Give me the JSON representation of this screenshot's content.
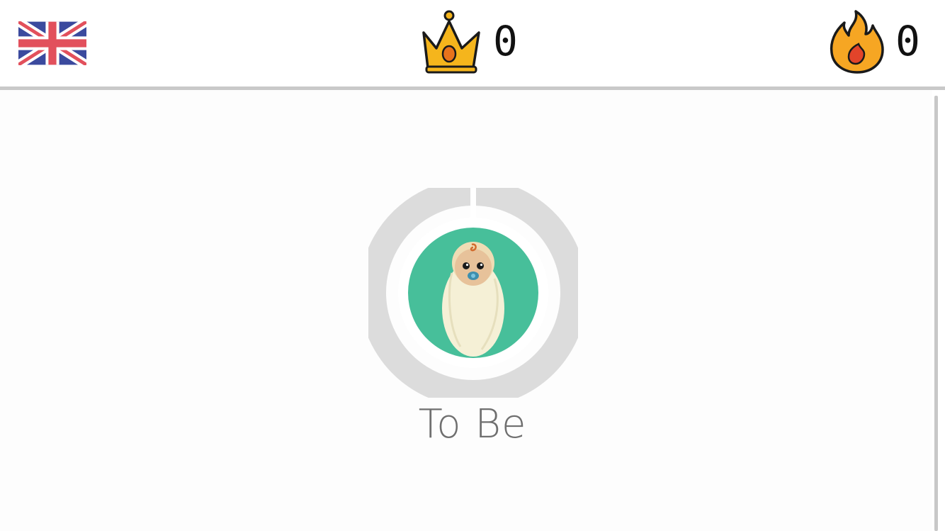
{
  "header": {
    "language_flag_icon": "uk-flag-icon",
    "crown": {
      "icon": "crown-icon",
      "count": "0"
    },
    "streak": {
      "icon": "fire-icon",
      "count": "0"
    }
  },
  "main": {
    "level": {
      "icon": "baby-icon",
      "label": "To Be",
      "progress": 0
    }
  },
  "colors": {
    "ring_gray": "#dcdcdc",
    "badge_green": "#47bf9a",
    "crown_gold": "#f5b51c",
    "fire_orange": "#f6a623",
    "label_gray": "#6f6f6f"
  }
}
